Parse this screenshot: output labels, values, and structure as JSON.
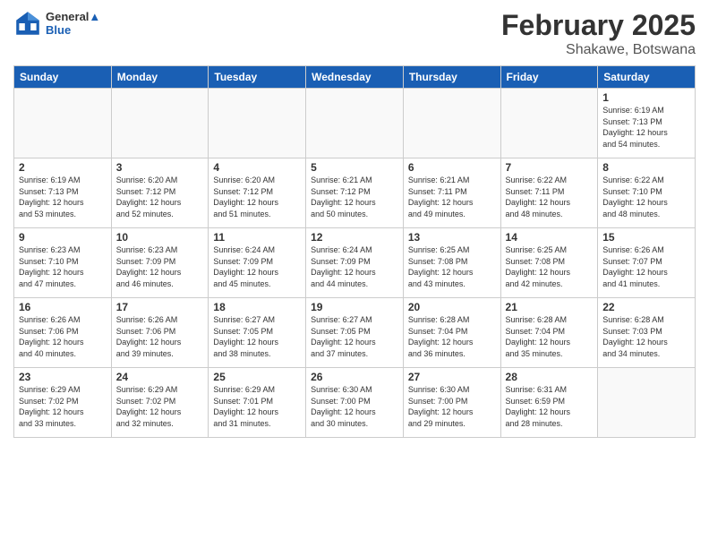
{
  "header": {
    "logo_line1": "General",
    "logo_line2": "Blue",
    "month_title": "February 2025",
    "location": "Shakawe, Botswana"
  },
  "weekdays": [
    "Sunday",
    "Monday",
    "Tuesday",
    "Wednesday",
    "Thursday",
    "Friday",
    "Saturday"
  ],
  "weeks": [
    {
      "alt": false,
      "days": [
        {
          "num": "",
          "empty": true,
          "info": ""
        },
        {
          "num": "",
          "empty": true,
          "info": ""
        },
        {
          "num": "",
          "empty": true,
          "info": ""
        },
        {
          "num": "",
          "empty": true,
          "info": ""
        },
        {
          "num": "",
          "empty": true,
          "info": ""
        },
        {
          "num": "",
          "empty": true,
          "info": ""
        },
        {
          "num": "1",
          "empty": false,
          "info": "Sunrise: 6:19 AM\nSunset: 7:13 PM\nDaylight: 12 hours\nand 54 minutes."
        }
      ]
    },
    {
      "alt": false,
      "days": [
        {
          "num": "2",
          "empty": false,
          "info": "Sunrise: 6:19 AM\nSunset: 7:13 PM\nDaylight: 12 hours\nand 53 minutes."
        },
        {
          "num": "3",
          "empty": false,
          "info": "Sunrise: 6:20 AM\nSunset: 7:12 PM\nDaylight: 12 hours\nand 52 minutes."
        },
        {
          "num": "4",
          "empty": false,
          "info": "Sunrise: 6:20 AM\nSunset: 7:12 PM\nDaylight: 12 hours\nand 51 minutes."
        },
        {
          "num": "5",
          "empty": false,
          "info": "Sunrise: 6:21 AM\nSunset: 7:12 PM\nDaylight: 12 hours\nand 50 minutes."
        },
        {
          "num": "6",
          "empty": false,
          "info": "Sunrise: 6:21 AM\nSunset: 7:11 PM\nDaylight: 12 hours\nand 49 minutes."
        },
        {
          "num": "7",
          "empty": false,
          "info": "Sunrise: 6:22 AM\nSunset: 7:11 PM\nDaylight: 12 hours\nand 48 minutes."
        },
        {
          "num": "8",
          "empty": false,
          "info": "Sunrise: 6:22 AM\nSunset: 7:10 PM\nDaylight: 12 hours\nand 48 minutes."
        }
      ]
    },
    {
      "alt": true,
      "days": [
        {
          "num": "9",
          "empty": false,
          "info": "Sunrise: 6:23 AM\nSunset: 7:10 PM\nDaylight: 12 hours\nand 47 minutes."
        },
        {
          "num": "10",
          "empty": false,
          "info": "Sunrise: 6:23 AM\nSunset: 7:09 PM\nDaylight: 12 hours\nand 46 minutes."
        },
        {
          "num": "11",
          "empty": false,
          "info": "Sunrise: 6:24 AM\nSunset: 7:09 PM\nDaylight: 12 hours\nand 45 minutes."
        },
        {
          "num": "12",
          "empty": false,
          "info": "Sunrise: 6:24 AM\nSunset: 7:09 PM\nDaylight: 12 hours\nand 44 minutes."
        },
        {
          "num": "13",
          "empty": false,
          "info": "Sunrise: 6:25 AM\nSunset: 7:08 PM\nDaylight: 12 hours\nand 43 minutes."
        },
        {
          "num": "14",
          "empty": false,
          "info": "Sunrise: 6:25 AM\nSunset: 7:08 PM\nDaylight: 12 hours\nand 42 minutes."
        },
        {
          "num": "15",
          "empty": false,
          "info": "Sunrise: 6:26 AM\nSunset: 7:07 PM\nDaylight: 12 hours\nand 41 minutes."
        }
      ]
    },
    {
      "alt": false,
      "days": [
        {
          "num": "16",
          "empty": false,
          "info": "Sunrise: 6:26 AM\nSunset: 7:06 PM\nDaylight: 12 hours\nand 40 minutes."
        },
        {
          "num": "17",
          "empty": false,
          "info": "Sunrise: 6:26 AM\nSunset: 7:06 PM\nDaylight: 12 hours\nand 39 minutes."
        },
        {
          "num": "18",
          "empty": false,
          "info": "Sunrise: 6:27 AM\nSunset: 7:05 PM\nDaylight: 12 hours\nand 38 minutes."
        },
        {
          "num": "19",
          "empty": false,
          "info": "Sunrise: 6:27 AM\nSunset: 7:05 PM\nDaylight: 12 hours\nand 37 minutes."
        },
        {
          "num": "20",
          "empty": false,
          "info": "Sunrise: 6:28 AM\nSunset: 7:04 PM\nDaylight: 12 hours\nand 36 minutes."
        },
        {
          "num": "21",
          "empty": false,
          "info": "Sunrise: 6:28 AM\nSunset: 7:04 PM\nDaylight: 12 hours\nand 35 minutes."
        },
        {
          "num": "22",
          "empty": false,
          "info": "Sunrise: 6:28 AM\nSunset: 7:03 PM\nDaylight: 12 hours\nand 34 minutes."
        }
      ]
    },
    {
      "alt": true,
      "days": [
        {
          "num": "23",
          "empty": false,
          "info": "Sunrise: 6:29 AM\nSunset: 7:02 PM\nDaylight: 12 hours\nand 33 minutes."
        },
        {
          "num": "24",
          "empty": false,
          "info": "Sunrise: 6:29 AM\nSunset: 7:02 PM\nDaylight: 12 hours\nand 32 minutes."
        },
        {
          "num": "25",
          "empty": false,
          "info": "Sunrise: 6:29 AM\nSunset: 7:01 PM\nDaylight: 12 hours\nand 31 minutes."
        },
        {
          "num": "26",
          "empty": false,
          "info": "Sunrise: 6:30 AM\nSunset: 7:00 PM\nDaylight: 12 hours\nand 30 minutes."
        },
        {
          "num": "27",
          "empty": false,
          "info": "Sunrise: 6:30 AM\nSunset: 7:00 PM\nDaylight: 12 hours\nand 29 minutes."
        },
        {
          "num": "28",
          "empty": false,
          "info": "Sunrise: 6:31 AM\nSunset: 6:59 PM\nDaylight: 12 hours\nand 28 minutes."
        },
        {
          "num": "",
          "empty": true,
          "info": ""
        }
      ]
    }
  ]
}
